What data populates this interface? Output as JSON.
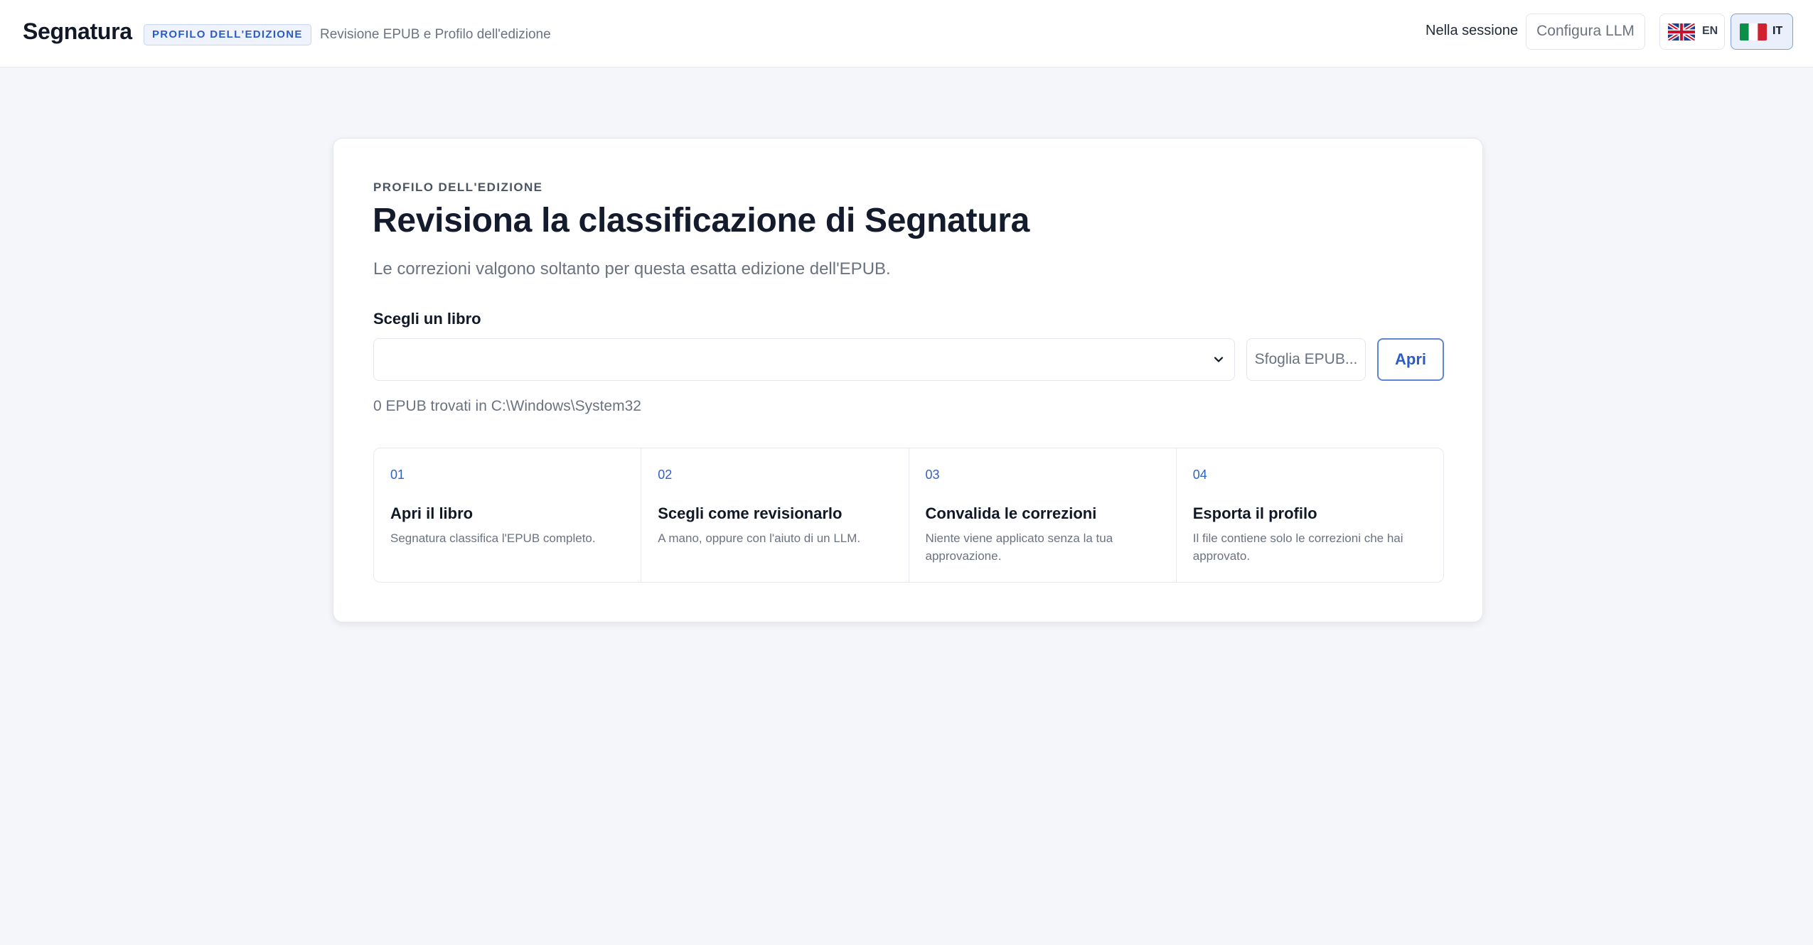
{
  "header": {
    "brand": "Segnatura",
    "badge": "PROFILO DELL'EDIZIONE",
    "subtitle": "Revisione EPUB e Profilo dell'edizione",
    "session_label": "Nella sessione",
    "configure_llm_label": "Configura LLM",
    "languages": [
      {
        "code": "EN",
        "flag": "uk-flag-icon",
        "active": false
      },
      {
        "code": "IT",
        "flag": "italy-flag-icon",
        "active": true
      }
    ]
  },
  "main": {
    "eyebrow": "PROFILO DELL'EDIZIONE",
    "title": "Revisiona la classificazione di Segnatura",
    "subtitle": "Le correzioni valgono soltanto per questa esatta edizione dell'EPUB.",
    "book_picker": {
      "label": "Scegli un libro",
      "selected_value": "",
      "browse_label": "Sfoglia EPUB...",
      "open_label": "Apri",
      "found_text": "0 EPUB trovati in C:\\Windows\\System32"
    },
    "steps": [
      {
        "number": "01",
        "title": "Apri il libro",
        "description": "Segnatura classifica l'EPUB completo."
      },
      {
        "number": "02",
        "title": "Scegli come revisionarlo",
        "description": "A mano, oppure con l'aiuto di un LLM."
      },
      {
        "number": "03",
        "title": "Convalida le correzioni",
        "description": "Niente viene applicato senza la tua approvazione."
      },
      {
        "number": "04",
        "title": "Esporta il profilo",
        "description": "Il file contiene solo le correzioni che hai approvato."
      }
    ]
  },
  "colors": {
    "accent": "#2c5bc9",
    "background": "#f5f6f9",
    "card": "#ffffff",
    "text": "#111827",
    "muted": "#6b7280"
  }
}
